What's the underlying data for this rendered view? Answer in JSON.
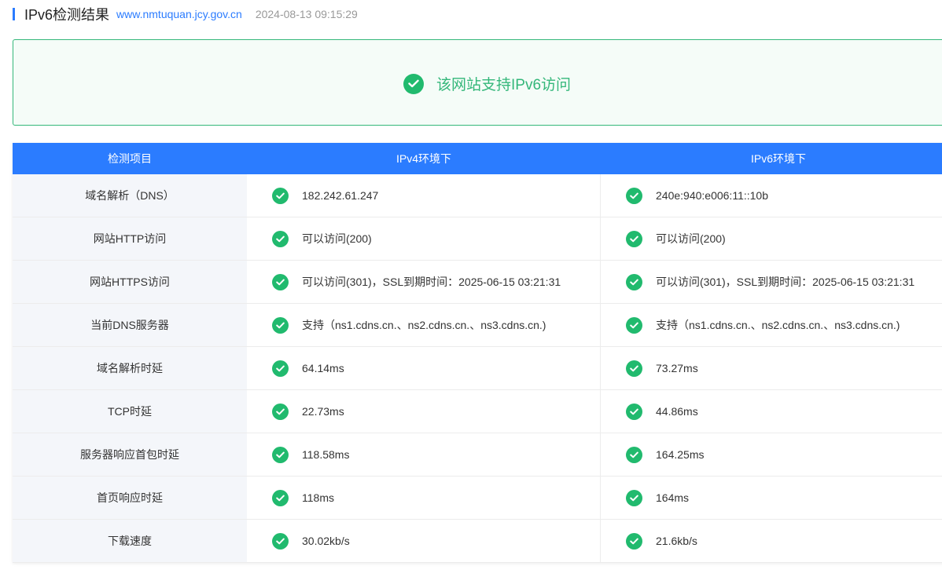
{
  "header": {
    "title": "IPv6检测结果",
    "domain": "www.nmtuquan.jcy.gov.cn",
    "timestamp": "2024-08-13 09:15:29"
  },
  "result": {
    "message": "该网站支持IPv6访问",
    "icon": "check-circle-icon",
    "color": "#21ba6e"
  },
  "table": {
    "headers": [
      "检测项目",
      "IPv4环境下",
      "IPv6环境下"
    ],
    "header_color": "#2b7cff",
    "rows": [
      {
        "item": "域名解析（DNS）",
        "ipv4": "182.242.61.247",
        "ipv6": "240e:940:e006:11::10b"
      },
      {
        "item": "网站HTTP访问",
        "ipv4": "可以访问(200)",
        "ipv6": "可以访问(200)"
      },
      {
        "item": "网站HTTPS访问",
        "ipv4": "可以访问(301)，SSL到期时间：2025-06-15 03:21:31",
        "ipv6": "可以访问(301)，SSL到期时间：2025-06-15 03:21:31"
      },
      {
        "item": "当前DNS服务器",
        "ipv4": "支持（ns1.cdns.cn.、ns2.cdns.cn.、ns3.cdns.cn.)",
        "ipv6": "支持（ns1.cdns.cn.、ns2.cdns.cn.、ns3.cdns.cn.)"
      },
      {
        "item": "域名解析时延",
        "ipv4": "64.14ms",
        "ipv6": "73.27ms"
      },
      {
        "item": "TCP时延",
        "ipv4": "22.73ms",
        "ipv6": "44.86ms"
      },
      {
        "item": "服务器响应首包时延",
        "ipv4": "118.58ms",
        "ipv6": "164.25ms"
      },
      {
        "item": "首页响应时延",
        "ipv4": "118ms",
        "ipv6": "164ms"
      },
      {
        "item": "下载速度",
        "ipv4": "30.02kb/s",
        "ipv6": "21.6kb/s"
      }
    ]
  }
}
